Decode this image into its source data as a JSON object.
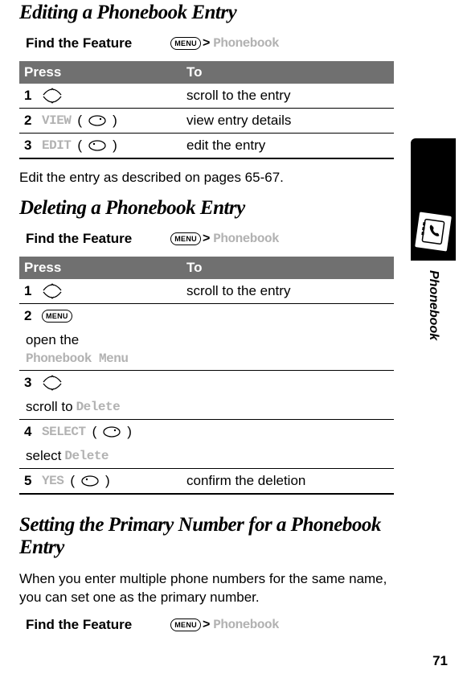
{
  "sections": {
    "editing": {
      "title": "Editing a Phonebook Entry",
      "find_feature_label": "Find the Feature",
      "menu_label": "MENU",
      "phonebook_label": "Phonebook",
      "after_text": "Edit the entry as described on pages 65-67."
    },
    "deleting": {
      "title": "Deleting a Phonebook Entry",
      "find_feature_label": "Find the Feature",
      "menu_label": "MENU",
      "phonebook_label": "Phonebook"
    },
    "primary": {
      "title": "Setting the Primary Number for a Phonebook Entry",
      "intro": "When you enter multiple phone numbers for the same name, you can set one as the primary number.",
      "find_feature_label": "Find the Feature",
      "menu_label": "MENU",
      "phonebook_label": "Phonebook"
    }
  },
  "table_headers": {
    "press": "Press",
    "to": "To"
  },
  "editing_steps": [
    {
      "num": "1",
      "action": "scroll to the entry"
    },
    {
      "num": "2",
      "label": "VIEW",
      "action": "view entry details"
    },
    {
      "num": "3",
      "label": "EDIT",
      "action": "edit the entry"
    }
  ],
  "deleting_steps": [
    {
      "num": "1",
      "action": "scroll to the entry"
    },
    {
      "num": "2",
      "action_pre": "open the ",
      "action_mono": "Phonebook Menu"
    },
    {
      "num": "3",
      "action_pre": "scroll to ",
      "action_mono": "Delete"
    },
    {
      "num": "4",
      "label": "SELECT",
      "action_pre": "select ",
      "action_mono": "Delete"
    },
    {
      "num": "5",
      "label": "YES",
      "action": "confirm the deletion"
    }
  ],
  "side_tab": {
    "label": "Phonebook"
  },
  "page_number": "71",
  "gt_symbol": ">"
}
